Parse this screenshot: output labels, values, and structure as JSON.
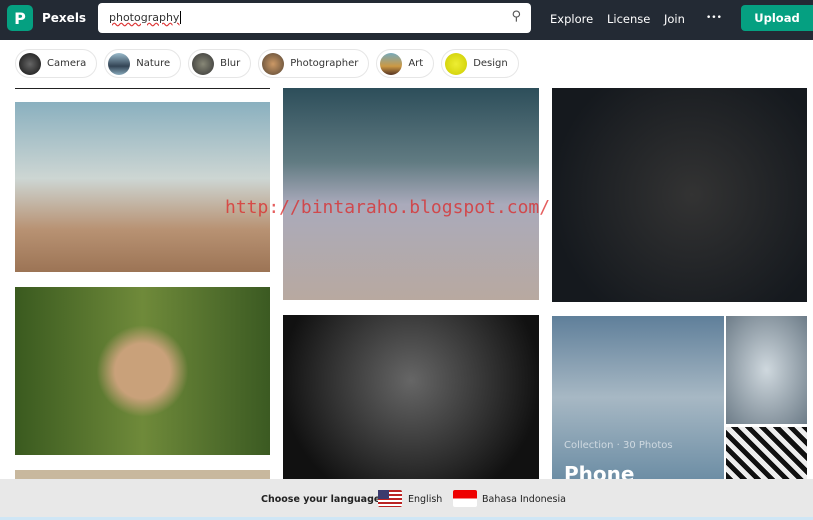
{
  "header": {
    "brand": "Pexels",
    "search_value": "photography",
    "nav": [
      "Explore",
      "License",
      "Join"
    ],
    "more": "•••",
    "upload": "Upload"
  },
  "chips": [
    "Camera",
    "Nature",
    "Blur",
    "Photographer",
    "Art",
    "Design"
  ],
  "watermark": "http://bintaraho.blogspot.com/",
  "collection": {
    "meta": "Collection · 30 Photos",
    "title": "Phone"
  },
  "footer": {
    "label": "Choose your language:",
    "languages": [
      "English",
      "Bahasa Indonesia"
    ]
  },
  "colors": {
    "accent": "#05a081",
    "header_bg": "#232a34"
  }
}
